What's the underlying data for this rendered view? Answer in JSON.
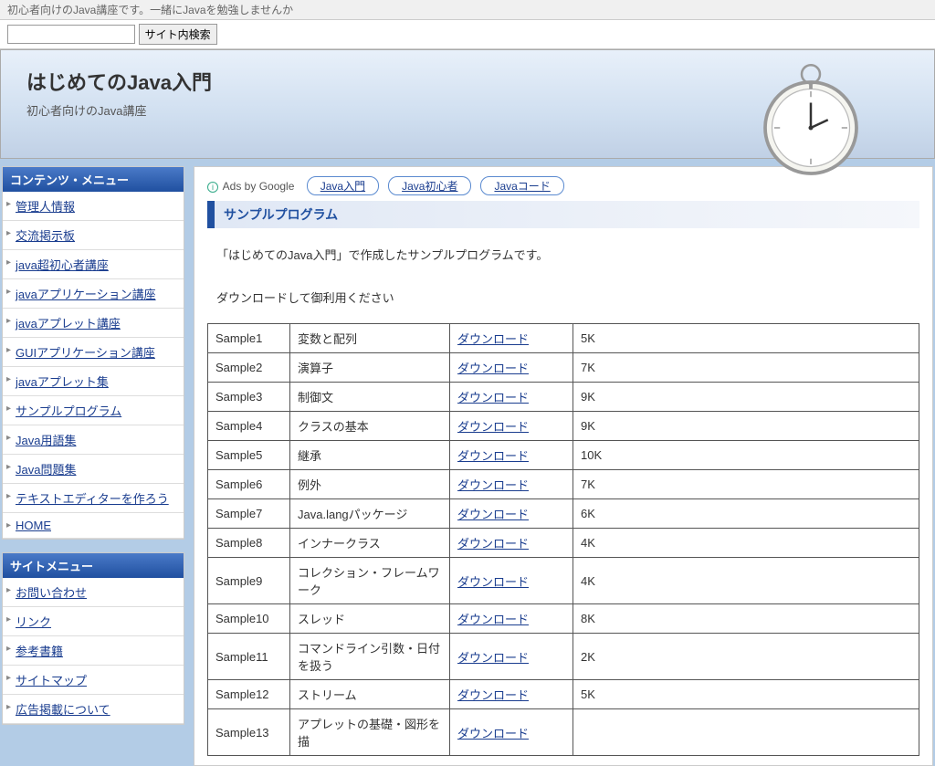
{
  "topbar": "初心者向けのJava講座です。一緒にJavaを勉強しませんか",
  "search": {
    "button": "サイト内検索"
  },
  "header": {
    "title": "はじめてのJava入門",
    "subtitle": "初心者向けのJava講座"
  },
  "ads": {
    "label": "Ads by Google",
    "pills": [
      "Java入門",
      "Java初心者",
      "Javaコード"
    ]
  },
  "page_title": "サンプルプログラム",
  "desc1": "「はじめてのJava入門」で作成したサンプルプログラムです。",
  "desc2": "ダウンロードして御利用ください",
  "dl_label": "ダウンロード",
  "menu1": {
    "title": "コンテンツ・メニュー",
    "items": [
      "管理人情報",
      "交流掲示板",
      "java超初心者講座",
      "javaアプリケーション講座",
      "javaアプレット講座",
      "GUIアプリケーション講座",
      "javaアプレット集",
      "サンプルプログラム",
      "Java用語集",
      "Java問題集",
      "テキストエディターを作ろう",
      "HOME"
    ]
  },
  "menu2": {
    "title": "サイトメニュー",
    "items": [
      "お問い合わせ",
      "リンク",
      "参考書籍",
      "サイトマップ",
      "広告掲載について"
    ]
  },
  "samples": [
    {
      "id": "Sample1",
      "name": "変数と配列",
      "size": "5K"
    },
    {
      "id": "Sample2",
      "name": "演算子",
      "size": "7K"
    },
    {
      "id": "Sample3",
      "name": "制御文",
      "size": "9K"
    },
    {
      "id": "Sample4",
      "name": "クラスの基本",
      "size": "9K"
    },
    {
      "id": "Sample5",
      "name": "継承",
      "size": "10K"
    },
    {
      "id": "Sample6",
      "name": "例外",
      "size": "7K"
    },
    {
      "id": "Sample7",
      "name": "Java.langパッケージ",
      "size": "6K"
    },
    {
      "id": "Sample8",
      "name": "インナークラス",
      "size": "4K"
    },
    {
      "id": "Sample9",
      "name": "コレクション・フレームワーク",
      "size": "4K"
    },
    {
      "id": "Sample10",
      "name": "スレッド",
      "size": "8K"
    },
    {
      "id": "Sample11",
      "name": "コマンドライン引数・日付を扱う",
      "size": "2K"
    },
    {
      "id": "Sample12",
      "name": "ストリーム",
      "size": "5K"
    },
    {
      "id": "Sample13",
      "name": "アプレットの基礎・図形を描",
      "size": ""
    }
  ]
}
